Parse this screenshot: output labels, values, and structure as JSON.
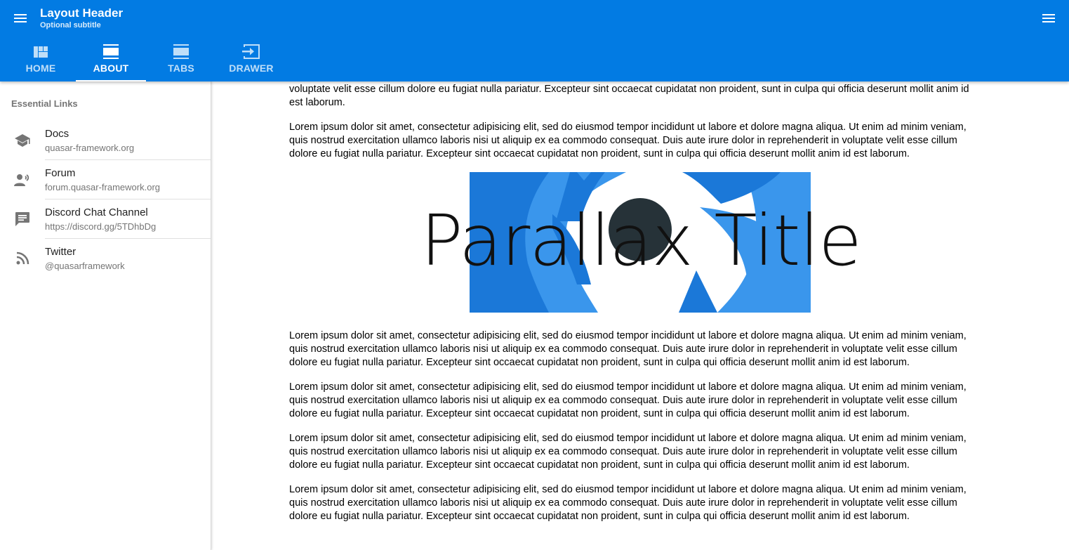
{
  "header": {
    "title": "Layout Header",
    "subtitle": "Optional subtitle",
    "background_color": "#027be3",
    "left_icon": "menu-icon",
    "right_icon": "menu-icon"
  },
  "tabs": [
    {
      "label": "HOME",
      "icon": "view-quilt-icon",
      "active": false
    },
    {
      "label": "ABOUT",
      "icon": "view-day-icon",
      "active": true
    },
    {
      "label": "TABS",
      "icon": "view-day-icon",
      "active": false
    },
    {
      "label": "DRAWER",
      "icon": "input-icon",
      "active": false
    }
  ],
  "drawer": {
    "heading": "Essential Links",
    "links": [
      {
        "title": "Docs",
        "subtitle": "quasar-framework.org",
        "icon": "school-icon"
      },
      {
        "title": "Forum",
        "subtitle": "forum.quasar-framework.org",
        "icon": "record-voice-icon"
      },
      {
        "title": "Discord Chat Channel",
        "subtitle": "https://discord.gg/5TDhbDg",
        "icon": "chat-icon"
      },
      {
        "title": "Twitter",
        "subtitle": "@quasarframework",
        "icon": "rss-feed-icon"
      }
    ]
  },
  "content": {
    "partial_paragraph": "voluptate velit esse cillum dolore eu fugiat nulla pariatur. Excepteur sint occaecat cupidatat non proident, sunt in culpa qui officia deserunt mollit anim id est laborum.",
    "paragraph": "Lorem ipsum dolor sit amet, consectetur adipisicing elit, sed do eiusmod tempor incididunt ut labore et dolore magna aliqua. Ut enim ad minim veniam, quis nostrud exercitation ullamco laboris nisi ut aliquip ex ea commodo consequat. Duis aute irure dolor in reprehenderit in voluptate velit esse cillum dolore eu fugiat nulla pariatur. Excepteur sint occaecat cupidatat non proident, sunt in culpa qui officia deserunt mollit anim id est laborum.",
    "parallax_title": "Parallax Title"
  }
}
